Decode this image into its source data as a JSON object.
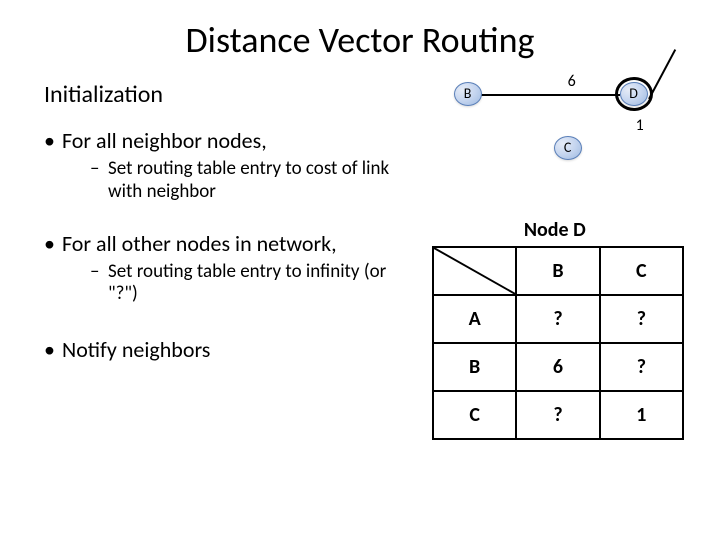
{
  "title": "Distance Vector Routing",
  "subtitle": "Initialization",
  "bullets": {
    "b1": "For all neighbor nodes,",
    "b1sub": "Set routing table entry to cost of link with neighbor",
    "b2": "For all other nodes in network,",
    "b2sub": "Set routing table entry to infinity (or \"?\")",
    "b3": "Notify neighbors"
  },
  "graph": {
    "nodeB": "B",
    "nodeD": "D",
    "nodeC": "C",
    "edgeBD": "6",
    "edgeDC": "1"
  },
  "table": {
    "title": "Node D",
    "colB": "B",
    "colC": "C",
    "rowA": "A",
    "rowB": "B",
    "rowC": "C",
    "cells": {
      "AB": "?",
      "AC": "?",
      "BB": "6",
      "BC": "?",
      "CB": "?",
      "CC": "1"
    }
  }
}
